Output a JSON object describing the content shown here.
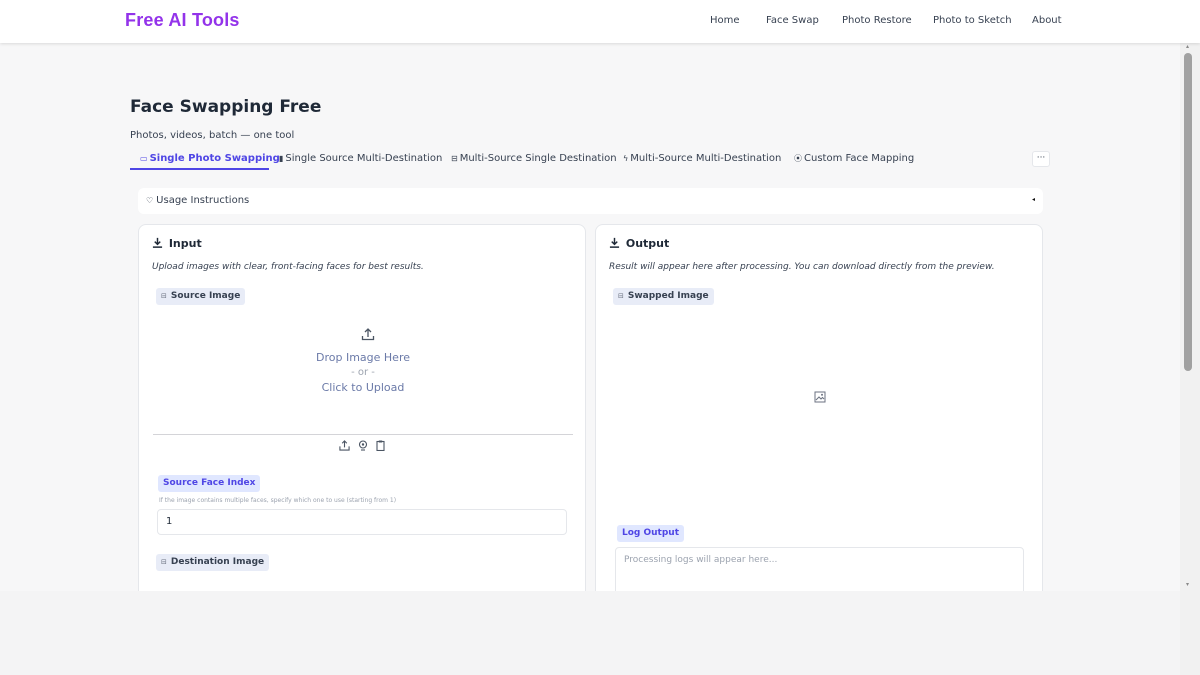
{
  "brand": "Free AI Tools",
  "nav": [
    "Home",
    "Face Swap",
    "Photo Restore",
    "Photo to Sketch",
    "About"
  ],
  "page": {
    "title": "Face Swapping Free",
    "subtitle": "Photos, videos, batch — one tool"
  },
  "tabs": [
    {
      "icon": "▭",
      "label": "Single Photo Swapping",
      "active": true
    },
    {
      "icon": "▮",
      "label": "Single Source Multi-Destination",
      "active": false
    },
    {
      "icon": "⊟",
      "label": "Multi-Source Single Destination",
      "active": false
    },
    {
      "icon": "ϟ",
      "label": "Multi-Source Multi-Destination",
      "active": false
    },
    {
      "icon": "⦿",
      "label": "Custom Face Mapping",
      "active": false
    }
  ],
  "more_label": "···",
  "accordion": {
    "icon": "♡",
    "label": "Usage Instructions",
    "caret": "◂"
  },
  "input_panel": {
    "title": "Input",
    "description": "Upload images with clear, front-facing faces for best results.",
    "source_image_label": "Source Image",
    "upload": {
      "drop": "Drop Image Here",
      "or": "- or -",
      "click": "Click to Upload"
    },
    "source_face_index_label": "Source Face Index",
    "source_face_index_hint": "If the image contains multiple faces, specify which one to use (starting from 1)",
    "source_face_index_value": "1",
    "destination_image_label": "Destination Image"
  },
  "output_panel": {
    "title": "Output",
    "description": "Result will appear here after processing. You can download directly from the preview.",
    "swapped_image_label": "Swapped Image",
    "log_output_label": "Log Output",
    "log_placeholder": "Processing logs will appear here..."
  },
  "colors": {
    "brand": "#9333ea",
    "accent": "#4f46e5"
  },
  "icons": {
    "upload": "upload-icon",
    "image": "image-icon",
    "webcam": "webcam-icon",
    "clipboard": "clipboard-icon"
  }
}
